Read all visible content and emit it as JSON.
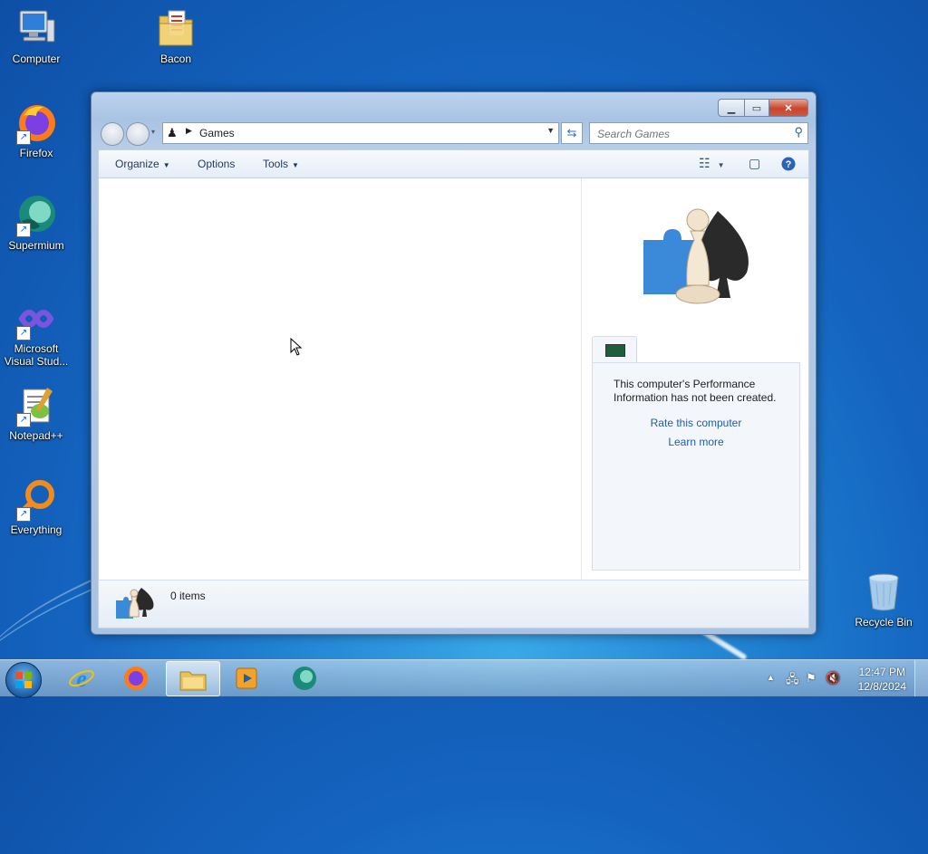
{
  "desktop": {
    "icons": [
      {
        "label": "Computer"
      },
      {
        "label": "Bacon"
      },
      {
        "label": "Firefox"
      },
      {
        "label": "Supermium"
      },
      {
        "label": "Microsoft Visual Stud..."
      },
      {
        "label": "Notepad++"
      },
      {
        "label": "Everything"
      },
      {
        "label": "Recycle Bin"
      }
    ]
  },
  "window": {
    "address": {
      "crumb": "Games"
    },
    "search": {
      "placeholder": "Search Games"
    },
    "toolbar": {
      "organize": "Organize",
      "options": "Options",
      "tools": "Tools"
    },
    "perf": {
      "message": "This computer's Performance Information has not been created.",
      "rate_link": "Rate this computer",
      "learn_link": "Learn more"
    },
    "details": {
      "count": "0 items"
    }
  },
  "taskbar": {
    "clock": {
      "time": "12:47 PM",
      "date": "12/8/2024"
    }
  },
  "colors": {
    "link": "#1f5fa6",
    "close_button": "#c8452e",
    "desktop_bg": "#1464bf"
  }
}
